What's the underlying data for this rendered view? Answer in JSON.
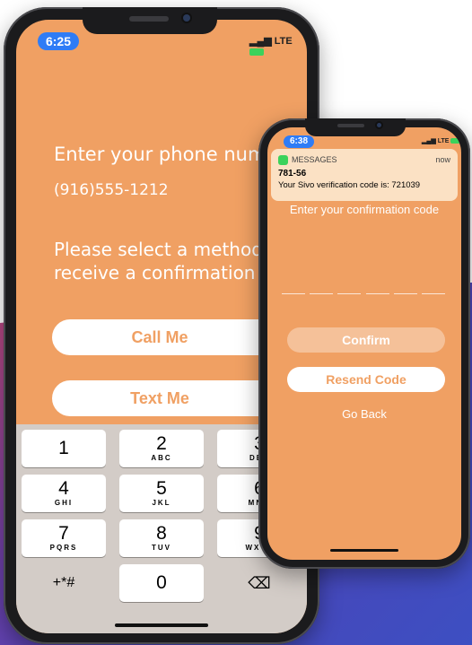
{
  "phone1": {
    "status": {
      "time": "6:25",
      "network": "LTE"
    },
    "phone_prompt": "Enter your phone number",
    "phone_number": "(916)555-1212",
    "method_prompt_line1": "Please select a method to",
    "method_prompt_line2": "receive a confirmation code",
    "call_button": "Call Me",
    "text_button": "Text Me",
    "keypad": [
      {
        "digit": "1",
        "letters": ""
      },
      {
        "digit": "2",
        "letters": "ABC"
      },
      {
        "digit": "3",
        "letters": "DEF"
      },
      {
        "digit": "4",
        "letters": "GHI"
      },
      {
        "digit": "5",
        "letters": "JKL"
      },
      {
        "digit": "6",
        "letters": "MNO"
      },
      {
        "digit": "7",
        "letters": "PQRS"
      },
      {
        "digit": "8",
        "letters": "TUV"
      },
      {
        "digit": "9",
        "letters": "WXYZ"
      },
      {
        "digit": "+*#",
        "letters": ""
      },
      {
        "digit": "0",
        "letters": ""
      },
      {
        "digit": "⌫",
        "letters": ""
      }
    ]
  },
  "phone2": {
    "status": {
      "time": "6:38",
      "network": "LTE"
    },
    "notification": {
      "app": "MESSAGES",
      "time": "now",
      "sender": "781-56",
      "body": "Your Sivo verification code is: 721039"
    },
    "code_prompt": "Enter your confirmation code",
    "confirm_button": "Confirm",
    "resend_button": "Resend Code",
    "back_link": "Go Back"
  },
  "colors": {
    "accent": "#f0a063",
    "notification_bg": "#fbe1c4",
    "time_pill": "#2f7cf6"
  }
}
